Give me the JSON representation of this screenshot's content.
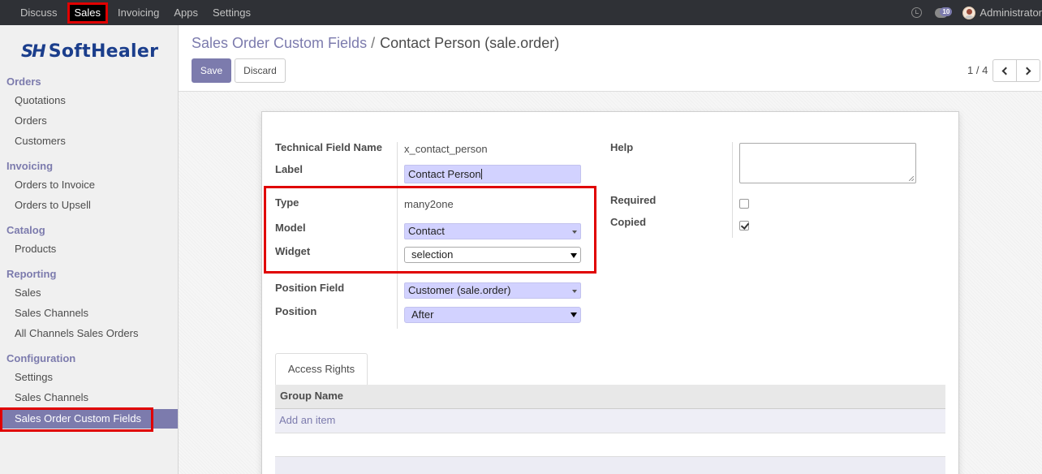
{
  "topbar": {
    "menu": [
      "Discuss",
      "Sales",
      "Invoicing",
      "Apps",
      "Settings"
    ],
    "active_menu": "Sales",
    "chat_badge": "10",
    "user": "Administrator"
  },
  "brand": {
    "mark": "SH",
    "name": "SoftHealer"
  },
  "sidebar": {
    "sections": [
      {
        "title": "Orders",
        "items": [
          "Quotations",
          "Orders",
          "Customers"
        ]
      },
      {
        "title": "Invoicing",
        "items": [
          "Orders to Invoice",
          "Orders to Upsell"
        ]
      },
      {
        "title": "Catalog",
        "items": [
          "Products"
        ]
      },
      {
        "title": "Reporting",
        "items": [
          "Sales",
          "Sales Channels",
          "All Channels Sales Orders"
        ]
      },
      {
        "title": "Configuration",
        "items": [
          "Settings",
          "Sales Channels",
          "Sales Order Custom Fields"
        ]
      }
    ],
    "active_item": "Sales Order Custom Fields"
  },
  "breadcrumb": {
    "parent": "Sales Order Custom Fields",
    "separator": "/",
    "current": "Contact Person (sale.order)"
  },
  "buttons": {
    "save": "Save",
    "discard": "Discard"
  },
  "pager": {
    "value": "1 / 4"
  },
  "form": {
    "technical_field_name": {
      "label": "Technical Field Name",
      "value": "x_contact_person"
    },
    "label_field": {
      "label": "Label",
      "value": "Contact Person"
    },
    "type": {
      "label": "Type",
      "value": "many2one"
    },
    "model": {
      "label": "Model",
      "value": "Contact"
    },
    "widget": {
      "label": "Widget",
      "value": "selection"
    },
    "position_field": {
      "label": "Position Field",
      "value": "Customer (sale.order)"
    },
    "position": {
      "label": "Position",
      "value": "After"
    },
    "help": {
      "label": "Help",
      "value": ""
    },
    "required": {
      "label": "Required",
      "checked": false
    },
    "copied": {
      "label": "Copied",
      "checked": true
    }
  },
  "notebook": {
    "tab": "Access Rights",
    "column": "Group Name",
    "add_item": "Add an item"
  },
  "colors": {
    "accent": "#7c7bad",
    "field_bg": "#d2d2ff",
    "highlight": "#e00000",
    "topbar": "#2f3136"
  }
}
